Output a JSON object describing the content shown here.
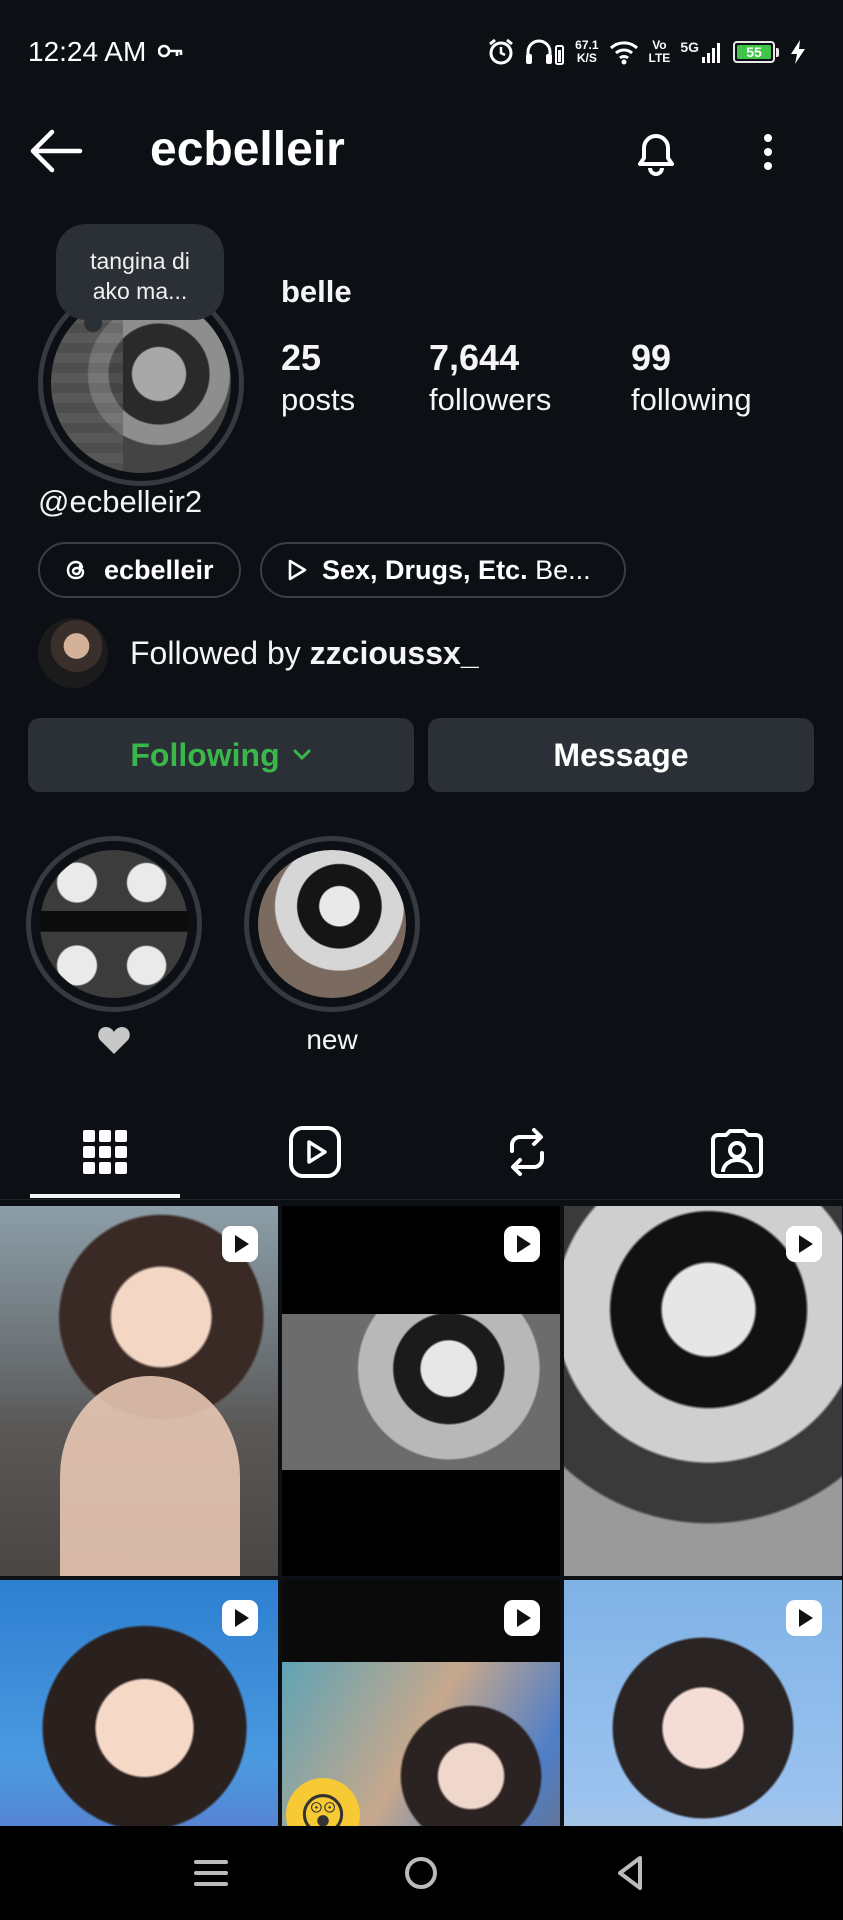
{
  "status_bar": {
    "time": "12:24 AM",
    "net_speed_value": "67.1",
    "net_speed_unit": "K/S",
    "volte_top": "Vo",
    "volte_bottom": "LTE",
    "signal_label": "5G",
    "battery_level": "55"
  },
  "header": {
    "username": "ecbelleir"
  },
  "profile": {
    "note": "tangina di ako ma...",
    "display_name": "belle",
    "stats": {
      "posts_count": "25",
      "posts_label": "posts",
      "followers_count": "7,644",
      "followers_label": "followers",
      "following_count": "99",
      "following_label": "following"
    },
    "threads_handle": "@ecbelleir2",
    "threads_chip": "ecbelleir",
    "music_chip_bold": "Sex, Drugs, Etc.",
    "music_chip_rest": " Be...",
    "followed_by_prefix": "Followed by ",
    "followed_by_user": "zzcioussx_"
  },
  "actions": {
    "following_label": "Following",
    "message_label": "Message"
  },
  "highlights": [
    {
      "label": "♥",
      "icon": "heart-icon"
    },
    {
      "label": "new"
    }
  ],
  "tabs": [
    {
      "name": "posts",
      "icon": "grid-icon",
      "active": true
    },
    {
      "name": "reels",
      "icon": "reels-icon",
      "active": false
    },
    {
      "name": "reposts",
      "icon": "repost-icon",
      "active": false
    },
    {
      "name": "tagged",
      "icon": "tagged-icon",
      "active": false
    }
  ],
  "posts": [
    {
      "type": "reel"
    },
    {
      "type": "reel"
    },
    {
      "type": "reel"
    },
    {
      "type": "reel"
    },
    {
      "type": "reel"
    },
    {
      "type": "reel"
    }
  ],
  "colors": {
    "background": "#0c1014",
    "button_bg": "#2b3036",
    "following_green": "#3ab74a",
    "battery_green": "#41c548"
  }
}
